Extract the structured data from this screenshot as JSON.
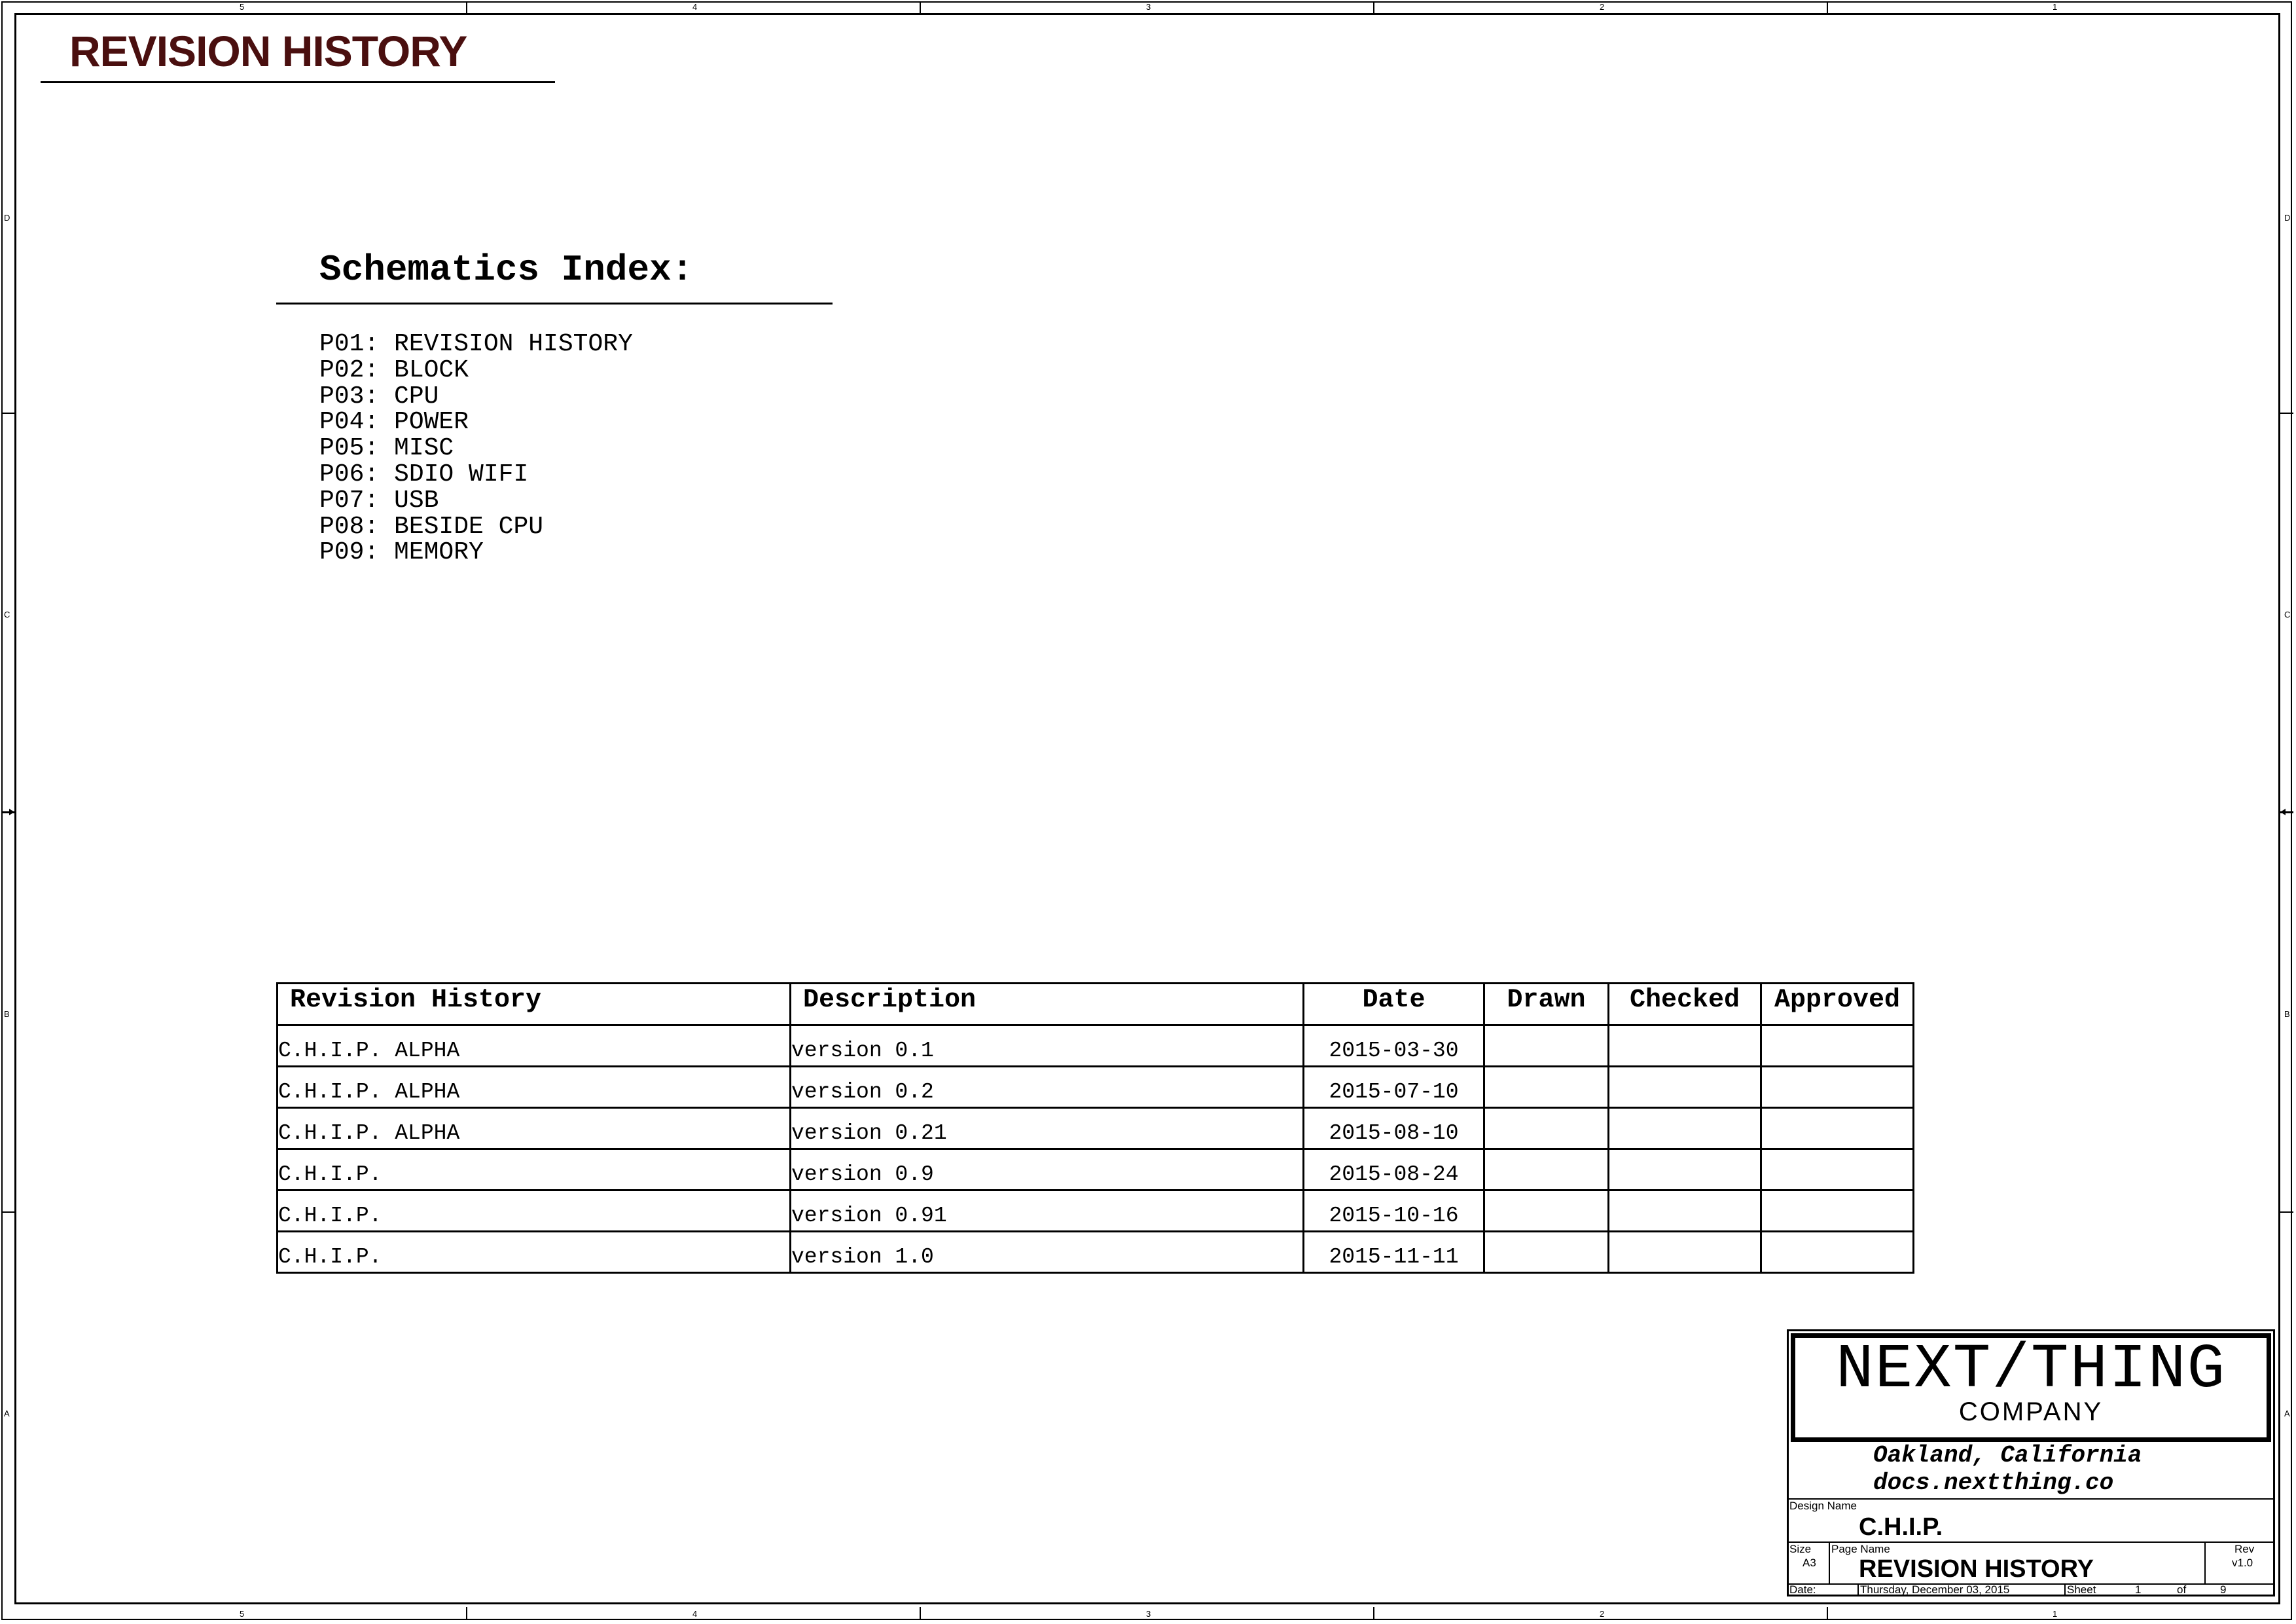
{
  "sheet_title": "REVISION HISTORY",
  "index": {
    "title": "Schematics Index:",
    "items": [
      "P01: REVISION HISTORY",
      "P02: BLOCK",
      "P03: CPU",
      "P04: POWER",
      "P05: MISC",
      "P06: SDIO WIFI",
      "P07: USB",
      "P08: BESIDE CPU",
      "P09: MEMORY"
    ]
  },
  "revision_table": {
    "headers": [
      "Revision History",
      "Description",
      "Date",
      "Drawn",
      "Checked",
      "Approved"
    ],
    "rows": [
      [
        "C.H.I.P. ALPHA",
        "version 0.1",
        "2015-03-30",
        "",
        "",
        ""
      ],
      [
        "C.H.I.P. ALPHA",
        "version 0.2",
        "2015-07-10",
        "",
        "",
        ""
      ],
      [
        "C.H.I.P. ALPHA",
        "version 0.21",
        "2015-08-10",
        "",
        "",
        ""
      ],
      [
        "C.H.I.P.",
        "version 0.9",
        "2015-08-24",
        "",
        "",
        ""
      ],
      [
        "C.H.I.P.",
        "version 0.91",
        "2015-10-16",
        "",
        "",
        ""
      ],
      [
        "C.H.I.P.",
        "version 1.0",
        "2015-11-11",
        "",
        "",
        ""
      ]
    ]
  },
  "title_block": {
    "company_name": "NEXT/THING",
    "company_sub": "COMPANY",
    "address_line1": "Oakland, California",
    "address_line2": "docs.nextthing.co",
    "design_name_label": "Design Name",
    "design_name": "C.H.I.P.",
    "size_label": "Size",
    "size": "A3",
    "page_name_label": "Page Name",
    "page_name": "REVISION HISTORY",
    "rev_label": "Rev",
    "rev": "v1.0",
    "date_label": "Date:",
    "date": "Thursday, December 03, 2015",
    "sheet_label": "Sheet",
    "sheet": "1",
    "of_label": "of",
    "total_sheets": "9"
  },
  "zones": {
    "columns": [
      "5",
      "4",
      "3",
      "2",
      "1"
    ],
    "rows": [
      "D",
      "C",
      "B",
      "A"
    ]
  }
}
